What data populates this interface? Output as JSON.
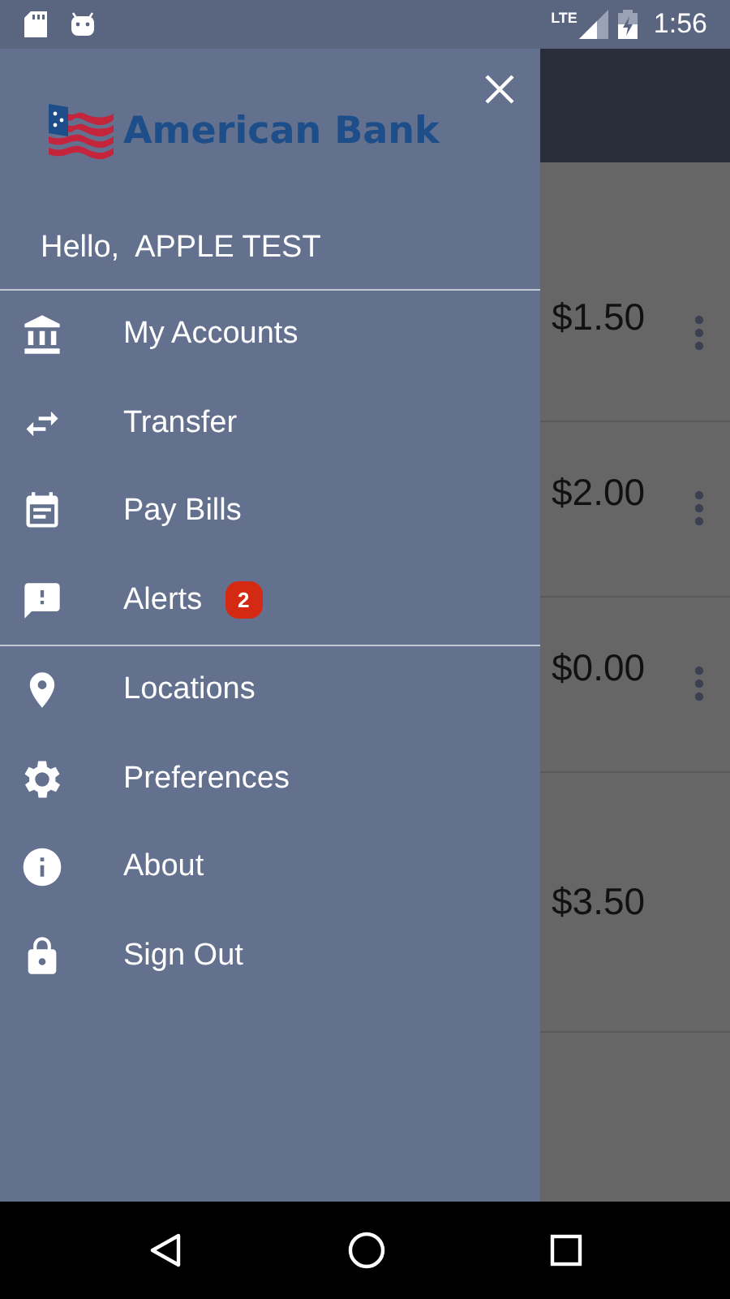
{
  "status_bar": {
    "network": "LTE",
    "time": "1:56"
  },
  "drawer": {
    "logo_text": "American Bank",
    "greeting": "Hello,  APPLE TEST",
    "menu_groups": [
      [
        {
          "label": "My Accounts",
          "kind": "bank"
        },
        {
          "label": "Transfer",
          "kind": "transfer"
        },
        {
          "label": "Pay Bills",
          "kind": "bills"
        },
        {
          "label": "Alerts",
          "kind": "alert",
          "badge": "2"
        }
      ],
      [
        {
          "label": "Locations",
          "kind": "pin"
        },
        {
          "label": "Preferences",
          "kind": "gear"
        },
        {
          "label": "About",
          "kind": "info"
        },
        {
          "label": "Sign Out",
          "kind": "lock"
        }
      ]
    ]
  },
  "background_list": [
    {
      "amount": "$1.50",
      "has_menu": true
    },
    {
      "amount": "$2.00",
      "has_menu": true
    },
    {
      "amount": "$0.00",
      "has_menu": true
    },
    {
      "amount": "$3.50",
      "has_menu": false
    }
  ]
}
